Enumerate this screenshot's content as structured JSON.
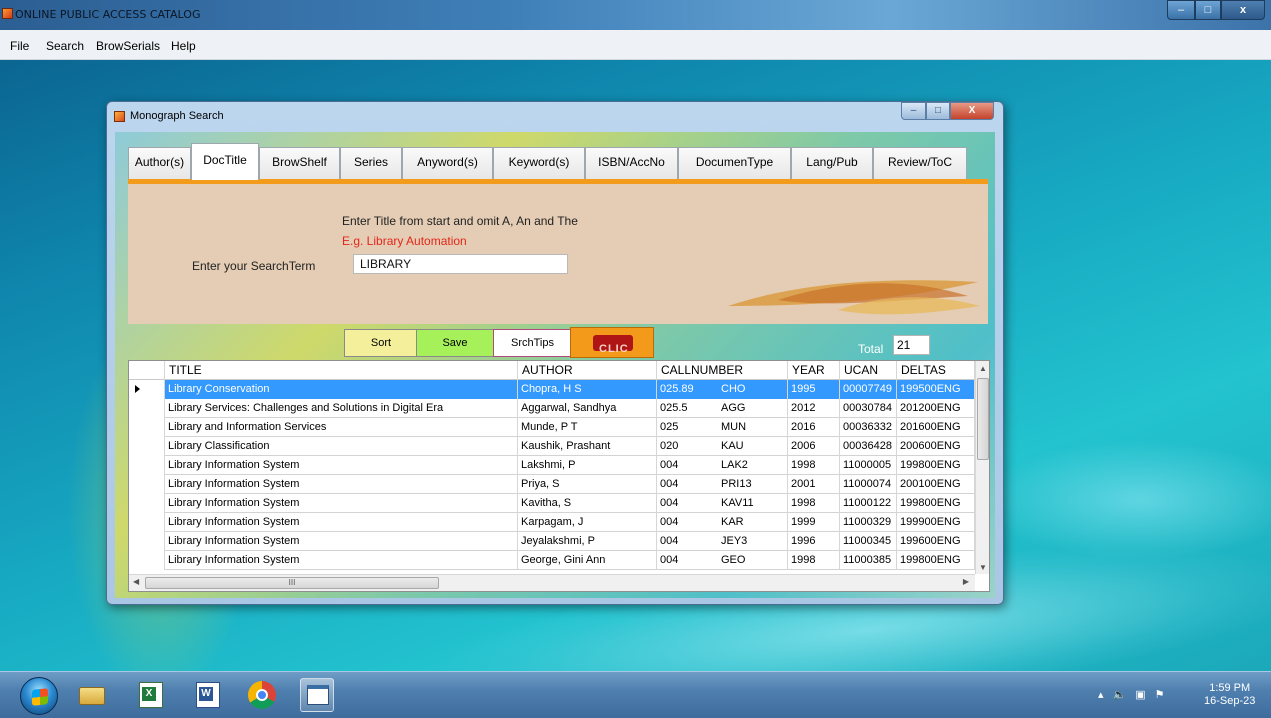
{
  "app": {
    "title": "ONLINE PUBLIC ACCESS CATALOG",
    "controls": {
      "minimize": "–",
      "maximize": "□",
      "close": "x"
    }
  },
  "menu": {
    "items": [
      "File",
      "Search",
      "BrowSerials",
      "Help"
    ]
  },
  "dialog": {
    "title": "Monograph Search",
    "controls": {
      "minimize": "–",
      "maximize": "□",
      "close": "X"
    },
    "tabs": [
      "Author(s)",
      "DocTitle",
      "BrowShelf",
      "Series",
      "Anyword(s)",
      "Keyword(s)",
      "ISBN/AccNo",
      "DocumenType",
      "Lang/Pub",
      "Review/ToC"
    ],
    "active_tab": "DocTitle",
    "hint_line": "Enter Title from start and omit  A, An and The",
    "example_line": "E.g. Library Automation",
    "search_label": "Enter your SearchTerm",
    "search_value": "LIBRARY",
    "buttons": {
      "sort": "Sort",
      "save": "Save",
      "tips": "SrchTips",
      "logo": "CLIC"
    },
    "total_label": "Total",
    "total_value": "21",
    "grid": {
      "columns": [
        "TITLE",
        "AUTHOR",
        "CALLNUMBER",
        "YEAR",
        "UCAN",
        "DELTAS"
      ],
      "rows": [
        {
          "title": "Library Conservation",
          "author": "Chopra, H S",
          "class": "025.89",
          "code": "CHO",
          "year": "1995",
          "ucan": "00007749",
          "deltas": "199500ENG"
        },
        {
          "title": "Library Services: Challenges and Solutions in Digital Era",
          "author": "Aggarwal, Sandhya",
          "class": "025.5",
          "code": "AGG",
          "year": "2012",
          "ucan": "00030784",
          "deltas": "201200ENG"
        },
        {
          "title": "Library and Information Services",
          "author": "Munde, P T",
          "class": "025",
          "code": "MUN",
          "year": "2016",
          "ucan": "00036332",
          "deltas": "201600ENG"
        },
        {
          "title": "Library Classification",
          "author": "Kaushik, Prashant",
          "class": "020",
          "code": "KAU",
          "year": "2006",
          "ucan": "00036428",
          "deltas": "200600ENG"
        },
        {
          "title": "Library Information System",
          "author": "Lakshmi, P",
          "class": "004",
          "code": "LAK2",
          "year": "1998",
          "ucan": "11000005",
          "deltas": "199800ENG"
        },
        {
          "title": "Library Information System",
          "author": "Priya, S",
          "class": "004",
          "code": "PRI13",
          "year": "2001",
          "ucan": "11000074",
          "deltas": "200100ENG"
        },
        {
          "title": "Library Information System",
          "author": "Kavitha, S",
          "class": "004",
          "code": "KAV11",
          "year": "1998",
          "ucan": "11000122",
          "deltas": "199800ENG"
        },
        {
          "title": "Library Information System",
          "author": "Karpagam, J",
          "class": "004",
          "code": "KAR",
          "year": "1999",
          "ucan": "11000329",
          "deltas": "199900ENG"
        },
        {
          "title": "Library Information System",
          "author": "Jeyalakshmi, P",
          "class": "004",
          "code": "JEY3",
          "year": "1996",
          "ucan": "11000345",
          "deltas": "199600ENG"
        },
        {
          "title": "Library Information System",
          "author": "George, Gini Ann",
          "class": "004",
          "code": "GEO",
          "year": "1998",
          "ucan": "11000385",
          "deltas": "199800ENG"
        }
      ],
      "selected_row": 0,
      "hscroll_grip": "III"
    }
  },
  "taskbar": {
    "icons": [
      "windows-start-icon",
      "file-explorer-icon",
      "excel-icon",
      "word-icon",
      "chrome-icon",
      "app-window-icon"
    ],
    "excel_glyph": "X",
    "word_glyph": "W",
    "tray": {
      "arrow": "▴",
      "volume": "🔈",
      "network": "▣",
      "flag": "⚑"
    },
    "clock": {
      "time": "1:59 PM",
      "date": "16-Sep-23"
    }
  },
  "colors": {
    "selection": "#3399ff",
    "tab_underline": "#f39c1b",
    "example_text": "#e3261b",
    "panel": "#e4cdb4",
    "sort_button": "#f3ef9a",
    "save_button": "#a6f05a",
    "logo_button": "#f49a1a"
  }
}
